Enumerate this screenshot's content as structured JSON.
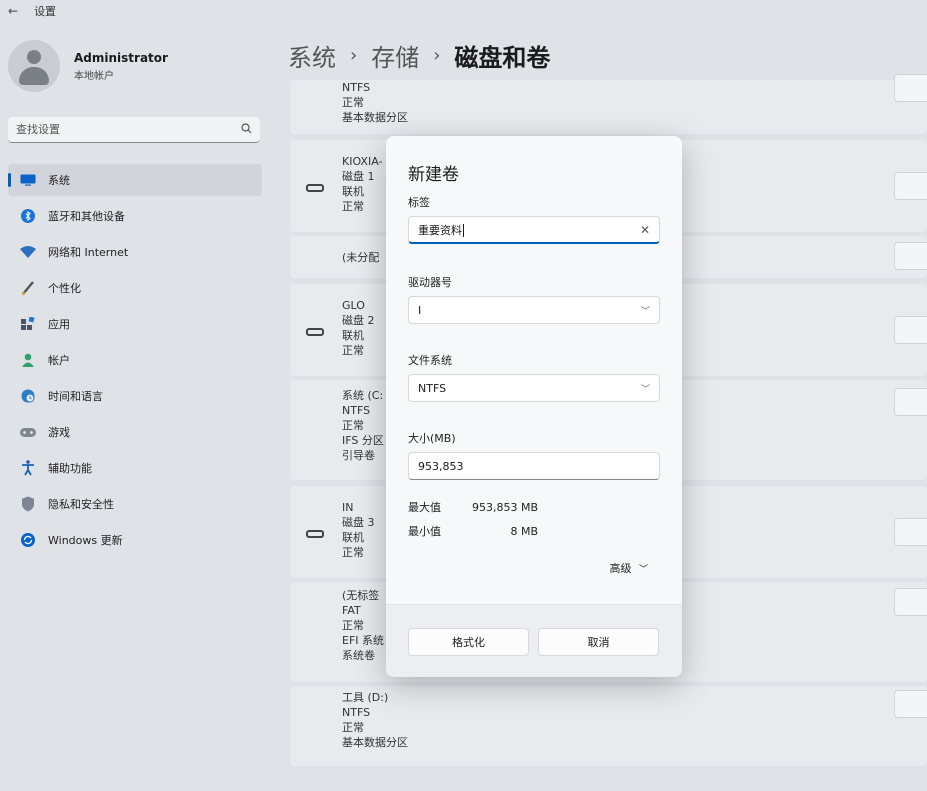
{
  "window": {
    "back_glyph": "←",
    "title": "设置"
  },
  "user": {
    "name": "Administrator",
    "account": "本地帐户"
  },
  "search": {
    "placeholder": "查找设置",
    "icon": "search-icon"
  },
  "nav": [
    {
      "label": "系统",
      "icon": "display-icon",
      "active": true
    },
    {
      "label": "蓝牙和其他设备",
      "icon": "bluetooth-icon"
    },
    {
      "label": "网络和 Internet",
      "icon": "wifi-icon"
    },
    {
      "label": "个性化",
      "icon": "brush-icon"
    },
    {
      "label": "应用",
      "icon": "apps-icon"
    },
    {
      "label": "帐户",
      "icon": "person-icon"
    },
    {
      "label": "时间和语言",
      "icon": "globe-clock-icon"
    },
    {
      "label": "游戏",
      "icon": "gamepad-icon"
    },
    {
      "label": "辅助功能",
      "icon": "accessibility-icon"
    },
    {
      "label": "隐私和安全性",
      "icon": "shield-icon"
    },
    {
      "label": "Windows 更新",
      "icon": "update-icon"
    }
  ],
  "breadcrumb": {
    "level1": "系统",
    "level2": "存储",
    "current": "磁盘和卷",
    "sep": "›"
  },
  "cards": {
    "c0": {
      "lines": [
        "NTFS",
        "正常",
        "基本数据分区"
      ]
    },
    "c1": {
      "lines": [
        "KIOXIA-",
        "磁盘 1",
        "联机",
        "正常"
      ]
    },
    "c2": {
      "lines": [
        "(未分配"
      ]
    },
    "c3": {
      "lines": [
        "GLO",
        "磁盘 2",
        "联机",
        "正常"
      ]
    },
    "c4": {
      "lines": [
        "系统 (C:",
        "NTFS",
        "正常",
        "IFS 分区",
        "引导卷"
      ]
    },
    "c5": {
      "lines": [
        "IN",
        "磁盘 3",
        "联机",
        "正常"
      ]
    },
    "c6": {
      "lines": [
        "(无标签",
        "FAT",
        "正常",
        "EFI 系统",
        "系统卷"
      ]
    },
    "c7": {
      "lines": [
        "工具 (D:)",
        "NTFS",
        "正常",
        "基本数据分区"
      ]
    }
  },
  "dialog": {
    "title": "新建卷",
    "label_label": "标签",
    "label_value": "重要资料",
    "drive_letter_label": "驱动器号",
    "drive_letter_value": "I",
    "fs_label": "文件系统",
    "fs_value": "NTFS",
    "size_label": "大小(MB)",
    "size_value": "953,853",
    "max_key": "最大值",
    "max_value": "953,853 MB",
    "min_key": "最小值",
    "min_value": "8 MB",
    "advanced": "高级",
    "format_button": "格式化",
    "cancel_button": "取消"
  },
  "colors": {
    "accent": "#005fb8"
  }
}
